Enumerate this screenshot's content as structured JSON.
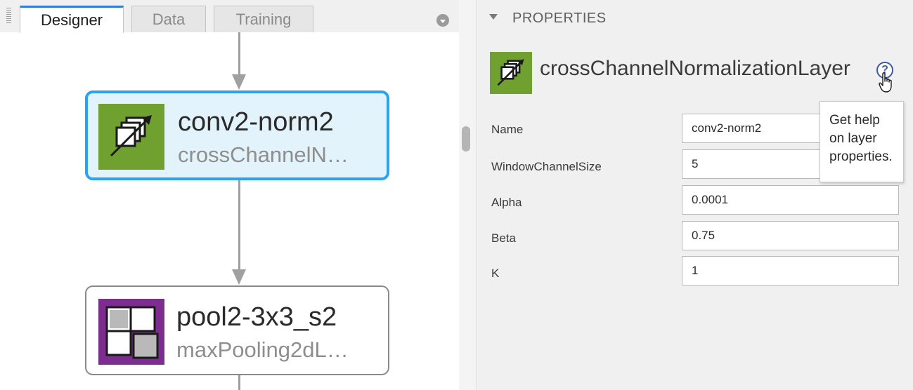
{
  "tabs": [
    {
      "label": "Designer",
      "active": true
    },
    {
      "label": "Data",
      "active": false
    },
    {
      "label": "Training",
      "active": false
    }
  ],
  "graph": {
    "nodes": [
      {
        "title": "conv2-norm2",
        "subtitle": "crossChannelN…",
        "selected": true,
        "icon": "cross-channel-normalization-icon",
        "color": "#70a030"
      },
      {
        "title": "pool2-3x3_s2",
        "subtitle": "maxPooling2dL…",
        "selected": false,
        "icon": "max-pooling-icon",
        "color": "#7d2d90"
      }
    ]
  },
  "properties": {
    "header": "PROPERTIES",
    "layer_type": "crossChannelNormalizationLayer",
    "help_tooltip": [
      "Get help",
      "on layer",
      "properties."
    ],
    "fields": [
      {
        "label": "Name",
        "value": "conv2-norm2"
      },
      {
        "label": "WindowChannelSize",
        "value": "5"
      },
      {
        "label": "Alpha",
        "value": "0.0001"
      },
      {
        "label": "Beta",
        "value": "0.75"
      },
      {
        "label": "K",
        "value": "1"
      }
    ]
  },
  "colors": {
    "accent": "#29a3f2",
    "tab_accent": "#2b7fd6",
    "normalization_layer": "#70a030",
    "pooling_layer": "#7d2d90"
  }
}
